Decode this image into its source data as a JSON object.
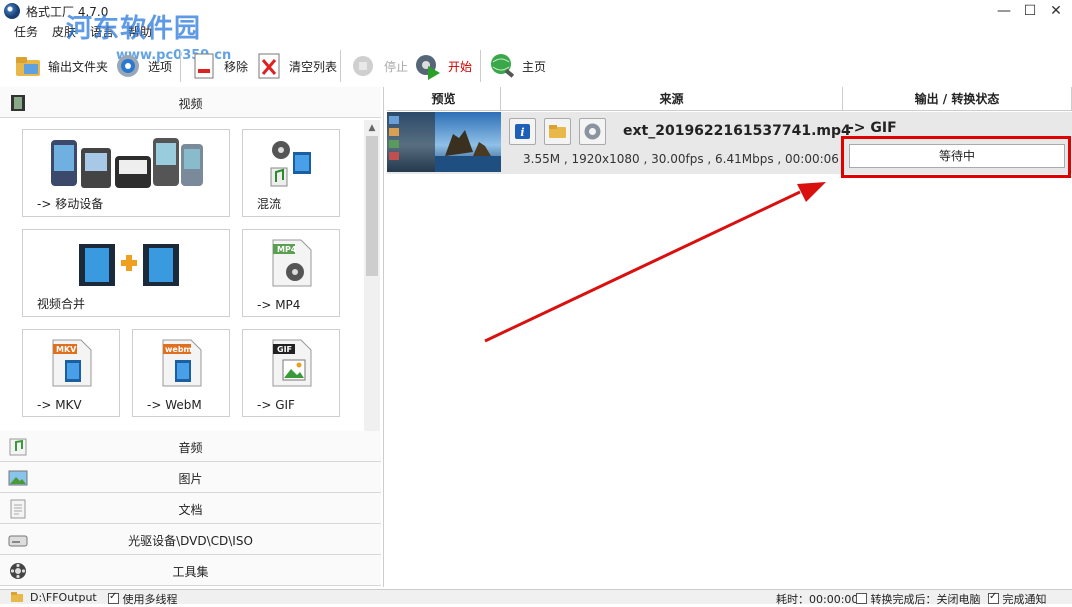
{
  "window": {
    "title": "格式工厂 4.7.0",
    "minimize": "—",
    "maximize": "☐",
    "close": "✕"
  },
  "watermark": {
    "text": "河东软件园",
    "url": "www.pc0359.cn"
  },
  "menu": [
    "任务",
    "皮肤",
    "语言",
    "帮助"
  ],
  "toolbar": {
    "output_folder": "输出文件夹",
    "options": "选项",
    "remove": "移除",
    "clear_list": "清空列表",
    "stop": "停止",
    "start": "开始",
    "home": "主页"
  },
  "categories": {
    "video": "视频",
    "audio": "音频",
    "picture": "图片",
    "document": "文档",
    "disc": "光驱设备\\DVD\\CD\\ISO",
    "tools": "工具集"
  },
  "tiles": [
    {
      "label": "-> 移动设备",
      "icon": "mobile-devices-icon"
    },
    {
      "label": "混流",
      "icon": "mux-icon"
    },
    {
      "label": "视频合并",
      "icon": "video-merge-icon"
    },
    {
      "label": "-> MP4",
      "icon": "mp4-file-icon",
      "badge": "MP4"
    },
    {
      "label": "-> MKV",
      "icon": "mkv-file-icon",
      "badge": "MKV"
    },
    {
      "label": "-> WebM",
      "icon": "webm-file-icon",
      "badge": "webm"
    },
    {
      "label": "-> GIF",
      "icon": "gif-file-icon",
      "badge": "GIF"
    }
  ],
  "columns": {
    "preview": "预览",
    "source": "来源",
    "output": "输出 / 转换状态"
  },
  "task": {
    "filename": "ext_2019622161537741.mp4",
    "info": "3.55M , 1920x1080 , 30.00fps , 6.41Mbps , 00:00:06",
    "output_format": "-> GIF",
    "status": "等待中"
  },
  "statusbar": {
    "output_path": "D:\\FFOutput",
    "multithread": "使用多线程",
    "elapsed": "耗时：00:00:00",
    "after_done": "转换完成后：关闭电脑",
    "notify": "完成通知"
  },
  "colors": {
    "highlight": "#e00000",
    "arrow": "#d81010"
  }
}
